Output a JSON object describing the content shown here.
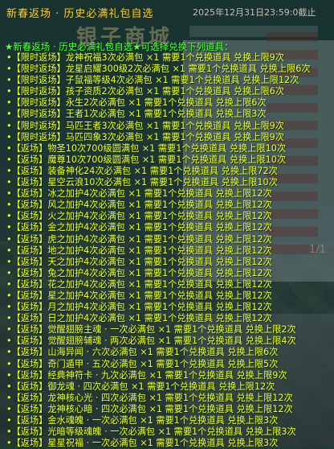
{
  "header": {
    "title": "新春返场 · 历史必满礼包自选",
    "deadline": "2025年12月31日23:59:0截止"
  },
  "background": {
    "big_text": "银子商城",
    "pager": "1/1"
  },
  "hint": "★新春返场 · 历史必满礼包自选★可选择兑换下列道具：",
  "items": [
    "•【限时返场】龙神祝福3次必满包 ×1  需要1个兑换道具  兑换上限9次",
    "•【限时返场】龙星启耀300级2次必满包 ×1  需要1个兑换道具  兑换上限6次",
    "•【限时返场】子鼠福等级4次必满包 ×1  需要1个兑换道具  兑换上限12次",
    "•【限时返场】孩子资质2次必满包 ×1  需要1个兑换道具  兑换上限6次",
    "•【限时返场】永生2次必满包 ×1  需要1个兑换道具  兑换上限6次",
    "•【限时返场】王者1次必满包 ×1  需要1个兑换道具  兑换上限3次",
    "•【限时返场】马匹王者3次必满包 ×1  需要1个兑换道具  兑换上限9次",
    "•【限时返场】马匹四象3次必满包 ×1  需要1个兑换道具  兑换上限9次",
    "•【返场】物圣10次700级圆满包 ×1  需要1个兑换道具  兑换上限10次",
    "•【返场】魔尊10次700级圆满包 ×1  需要1个兑换道具  兑换上限10次",
    "•【返场】装备神化24次必满包 ×1  需要1个兑换道具  兑换上限72次",
    "•【返场】星空云浪10次必满包 ×1  需要1个兑换道具  兑换上限10次",
    "•【返场】冰之加护4次必满包 ×1  需要1个兑换道具  兑换上限12次",
    "•【返场】风之加护4次必满包 ×1  需要1个兑换道具  兑换上限12次",
    "•【返场】火之加护4次必满包 ×1  需要1个兑换道具  兑换上限12次",
    "•【返场】金之加护4次必满包 ×1  需要1个兑换道具  兑换上限12次",
    "•【返场】虎之加护4次必满包 ×1  需要1个兑换道具  兑换上限12次",
    "•【返场】地之加护4次必满包 ×1  需要1个兑换道具  兑换上限12次",
    "•【返场】天之加护4次必满包 ×1  需要1个兑换道具  兑换上限12次",
    "•【返场】兔之加护4次必满包 ×1  需要1个兑换道具  兑换上限12次",
    "•【返场】花之加护4次必满包 ×1  需要1个兑换道具  兑换上限12次",
    "•【返场】星之加护4次必满包 ×1  需要1个兑换道具  兑换上限12次",
    "•【返场】月之加护4次必满包 ×1  需要1个兑换道具  兑换上限12次",
    "•【返场】日之加护4次必满包 ×1  需要1个兑换道具  兑换上限12次",
    "•【返场】觉醒翅膀主魂 · 一次必满包 ×1  需要1个兑换道具  兑换上限2次",
    "•【返场】觉醒翅膀辅魂 · 两次必满包 ×1  需要1个兑换道具  兑换上限4次",
    "•【返场】山海异闻 · 六次必满包 ×1  需要1个兑换道具  兑换上限6次",
    "•【返场】奇门遁甲 · 五次必满包 ×1  需要1个兑换道具  兑换上限5次",
    "•【返场】经典神符卡 · 九次必满包 ×1  需要1个兑换道具  兑换上限9次",
    "•【返场】御龙魂 · 四次必满包 ×1  需要1个兑换道具  兑换上限12次",
    "•【返场】龙神核心光 · 四次必满包 ×1  需要1个兑换道具  兑换上限12次",
    "•【返场】龙神核心暗 · 四次必满包 ×1  需要1个兑换道具  兑换上限12次",
    "•【返场】金水魂魄 · 一次必满包 ×1  需要1个兑换道具  兑换上限3次",
    "•【返场】光暗等级魂魄 · 一次必满包 ×1  需要1个兑换道具  兑换上限3次",
    "•【返场】星星祝福 · 一次必满包 ×1  需要1个兑换道具  兑换上限3次"
  ]
}
